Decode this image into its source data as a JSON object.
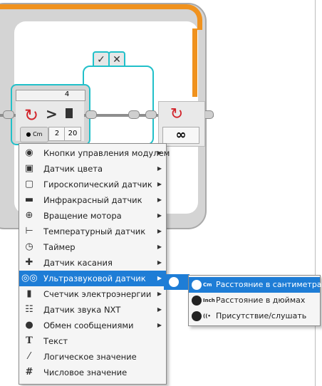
{
  "program": {
    "switch_case_number": "4",
    "switch_compare_symbol": ">",
    "switch_value_1": "2",
    "switch_value_2": "20",
    "case_true_symbol": "✓",
    "case_false_symbol": "✕",
    "loop_mode_symbol": "∞"
  },
  "menu": {
    "items": [
      {
        "label": "Кнопки управления модулем",
        "icon": "brick-buttons-icon",
        "has_submenu": true
      },
      {
        "label": "Датчик цвета",
        "icon": "color-sensor-icon",
        "has_submenu": true
      },
      {
        "label": "Гироскопический датчик",
        "icon": "gyro-sensor-icon",
        "has_submenu": true
      },
      {
        "label": "Инфракрасный датчик",
        "icon": "infrared-sensor-icon",
        "has_submenu": true
      },
      {
        "label": "Вращение мотора",
        "icon": "motor-rotation-icon",
        "has_submenu": true
      },
      {
        "label": "Температурный датчик",
        "icon": "temperature-sensor-icon",
        "has_submenu": true
      },
      {
        "label": "Таймер",
        "icon": "timer-icon",
        "has_submenu": true
      },
      {
        "label": "Датчик касания",
        "icon": "touch-sensor-icon",
        "has_submenu": true
      },
      {
        "label": "Ультразвуковой датчик",
        "icon": "ultrasonic-sensor-icon",
        "has_submenu": true
      },
      {
        "label": "Счетчик электроэнергии",
        "icon": "energy-meter-icon",
        "has_submenu": true
      },
      {
        "label": "Датчик звука NXT",
        "icon": "nxt-sound-sensor-icon",
        "has_submenu": true
      },
      {
        "label": "Обмен сообщениями",
        "icon": "bluetooth-messaging-icon",
        "has_submenu": true
      },
      {
        "label": "Текст",
        "icon": "text-icon",
        "has_submenu": false
      },
      {
        "label": "Логическое значение",
        "icon": "logic-value-icon",
        "has_submenu": false
      },
      {
        "label": "Числовое значение",
        "icon": "numeric-value-icon",
        "has_submenu": false
      }
    ],
    "selected_index": 8
  },
  "submenu": {
    "items": [
      {
        "label": "Расстояние в сантиметрах",
        "mini": "Cm"
      },
      {
        "label": "Расстояние в дюймах",
        "mini": "Inch"
      },
      {
        "label": "Присутствие/слушать",
        "mini": "((•"
      }
    ],
    "selected_index": 0
  },
  "colors": {
    "accent": "#1e7dd6",
    "loop_orange": "#f0921e",
    "switch_teal": "#21c0c9",
    "block_red": "#d2232a"
  }
}
